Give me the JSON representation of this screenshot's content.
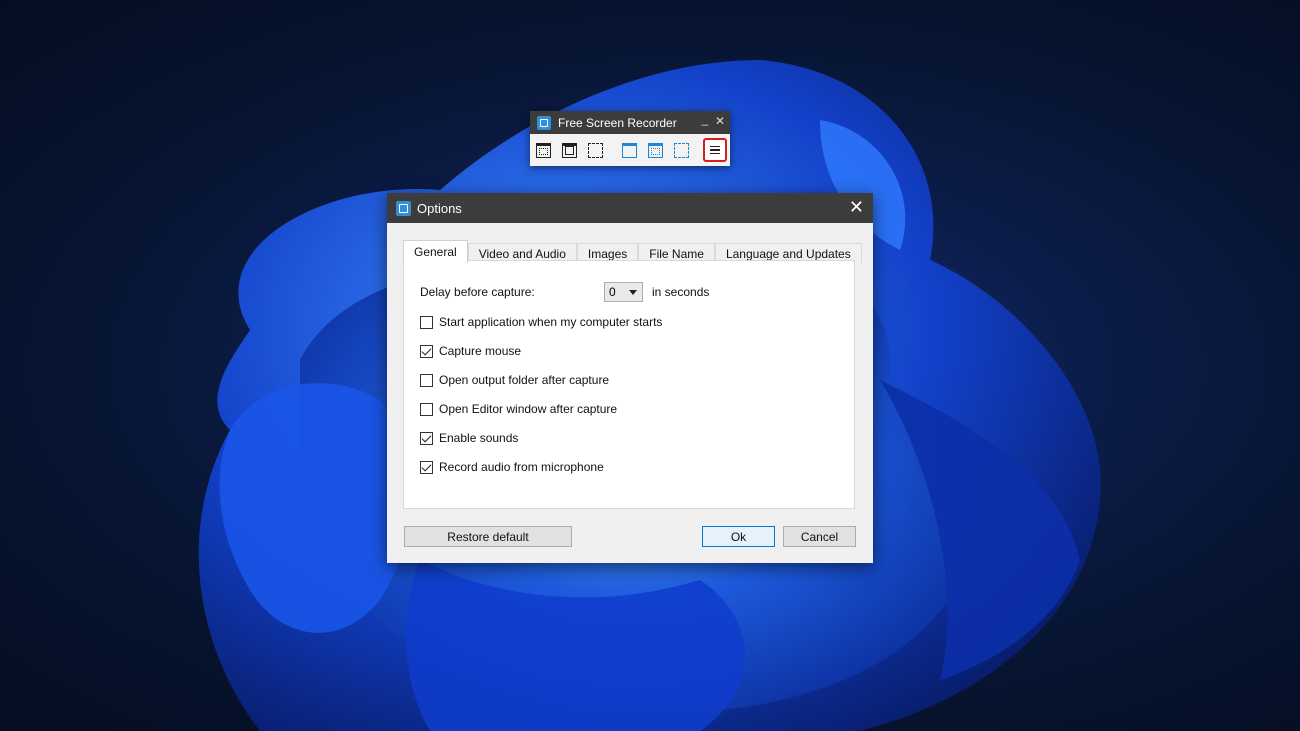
{
  "recorder": {
    "title": "Free Screen Recorder",
    "minimize_glyph": "_",
    "close_glyph": "✕",
    "tools": [
      {
        "name": "capture-window-icon"
      },
      {
        "name": "capture-object-icon"
      },
      {
        "name": "capture-region-icon"
      },
      {
        "name": "record-window-icon"
      },
      {
        "name": "record-object-icon"
      },
      {
        "name": "record-region-icon"
      }
    ],
    "menu_icon": "hamburger-menu-icon"
  },
  "dialog": {
    "title": "Options",
    "close_glyph": "✕",
    "tabs": [
      {
        "label": "General",
        "active": true
      },
      {
        "label": "Video and Audio"
      },
      {
        "label": "Images"
      },
      {
        "label": "File Name"
      },
      {
        "label": "Language and Updates"
      }
    ],
    "general": {
      "delay_label": "Delay before capture:",
      "delay_value": "0",
      "delay_unit": "in seconds",
      "options": [
        {
          "label": "Start application when my computer starts",
          "checked": false
        },
        {
          "label": "Capture mouse",
          "checked": true
        },
        {
          "label": "Open output folder after capture",
          "checked": false
        },
        {
          "label": "Open Editor window after capture",
          "checked": false
        },
        {
          "label": "Enable sounds",
          "checked": true
        },
        {
          "label": "Record audio from microphone",
          "checked": true
        }
      ]
    },
    "buttons": {
      "restore": "Restore default",
      "ok": "Ok",
      "cancel": "Cancel"
    }
  },
  "colors": {
    "accent": "#0078d7",
    "titlebar": "#3c3c3c",
    "highlight_border": "#d02020",
    "app_icon": "#2f8fd8"
  }
}
